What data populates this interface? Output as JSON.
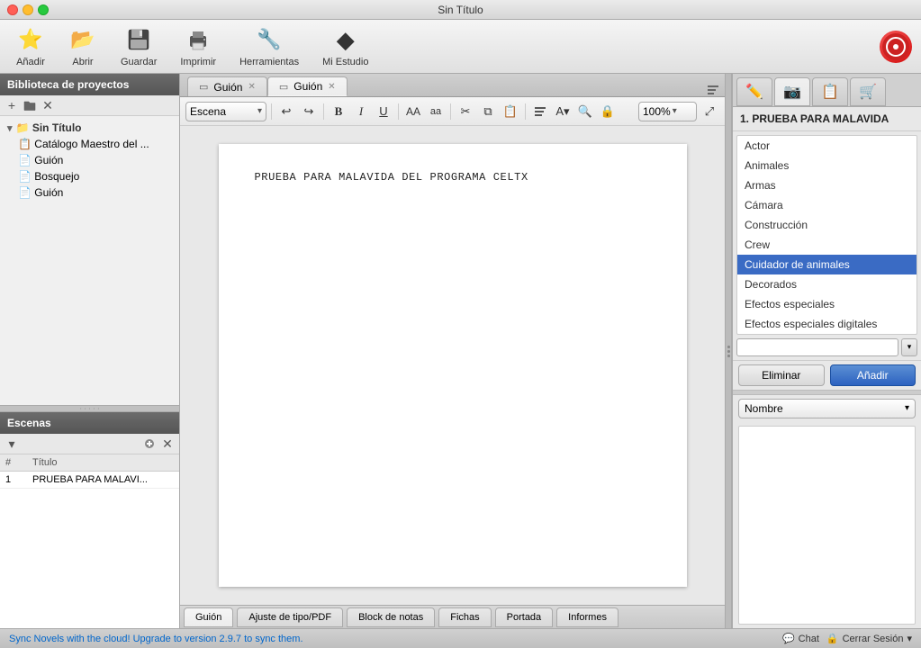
{
  "window": {
    "title": "Sin Título"
  },
  "toolbar": {
    "items": [
      {
        "id": "add",
        "label": "Añadir",
        "icon": "⭐"
      },
      {
        "id": "open",
        "label": "Abrir",
        "icon": "📂"
      },
      {
        "id": "save",
        "label": "Guardar",
        "icon": "💾"
      },
      {
        "id": "print",
        "label": "Imprimir",
        "icon": "🖨"
      },
      {
        "id": "tools",
        "label": "Herramientas",
        "icon": "🔧"
      },
      {
        "id": "mystudio",
        "label": "Mi Estudio",
        "icon": "◆"
      }
    ]
  },
  "sidebar": {
    "header": "Biblioteca de proyectos",
    "btns": {
      "add": "+",
      "folder": "📁",
      "close": "✕"
    },
    "tree": {
      "root": "Sin Título",
      "children": [
        {
          "label": "Catálogo Maestro del ...",
          "icon": "📋",
          "indent": 1
        },
        {
          "label": "Guión",
          "icon": "📄",
          "indent": 1
        },
        {
          "label": "Bosquejo",
          "icon": "📄",
          "indent": 1
        },
        {
          "label": "Guión",
          "icon": "📄",
          "indent": 1
        }
      ]
    }
  },
  "scenes": {
    "header": "Escenas",
    "cols": [
      "#",
      "Título"
    ],
    "rows": [
      {
        "num": "1",
        "title": "PRUEBA PARA MALAVI..."
      }
    ]
  },
  "tabs": [
    {
      "label": "Guión",
      "active": false
    },
    {
      "label": "Guión",
      "active": true
    }
  ],
  "format_toolbar": {
    "scene_select": "Escena",
    "zoom": "100%",
    "undo_icon": "↩",
    "redo_icon": "↪",
    "bold_icon": "B",
    "italic_icon": "I",
    "underline_icon": "U",
    "font_large": "AA",
    "font_small": "aa"
  },
  "script": {
    "text": "PRUEBA  PARA  MALAVIDA  DEL  PROGRAMA  CELTX"
  },
  "bottom_tabs": [
    {
      "label": "Guión",
      "active": true
    },
    {
      "label": "Ajuste de tipo/PDF",
      "active": false
    },
    {
      "label": "Block de notas",
      "active": false
    },
    {
      "label": "Fichas",
      "active": false
    },
    {
      "label": "Portada",
      "active": false
    },
    {
      "label": "Informes",
      "active": false
    }
  ],
  "right_panel": {
    "tabs": [
      {
        "icon": "✏️",
        "id": "edit"
      },
      {
        "icon": "📷",
        "id": "photo"
      },
      {
        "icon": "📋",
        "id": "list"
      },
      {
        "icon": "🛒",
        "id": "shop"
      }
    ],
    "title": "1. PRUEBA PARA MALAVIDA",
    "categories": [
      {
        "label": "Actor",
        "selected": false
      },
      {
        "label": "Animales",
        "selected": false
      },
      {
        "label": "Armas",
        "selected": false
      },
      {
        "label": "Cámara",
        "selected": false
      },
      {
        "label": "Construcción",
        "selected": false
      },
      {
        "label": "Crew",
        "selected": false
      },
      {
        "label": "Cuidador de animales",
        "selected": true
      },
      {
        "label": "Decorados",
        "selected": false
      },
      {
        "label": "Efectos especiales",
        "selected": false
      },
      {
        "label": "Efectos especiales digitales",
        "selected": false
      }
    ],
    "btn_eliminar": "Eliminar",
    "btn_anadir": "Añadir",
    "nombre_label": "Nombre",
    "input_placeholder": ""
  },
  "status_bar": {
    "sync_text": "Sync Novels with the cloud! Upgrade to version 2.9.7 to sync them.",
    "chat_icon": "💬",
    "chat_label": "Chat",
    "lock_icon": "🔒",
    "session_label": "Cerrar Sesión",
    "arrow": "▾"
  }
}
